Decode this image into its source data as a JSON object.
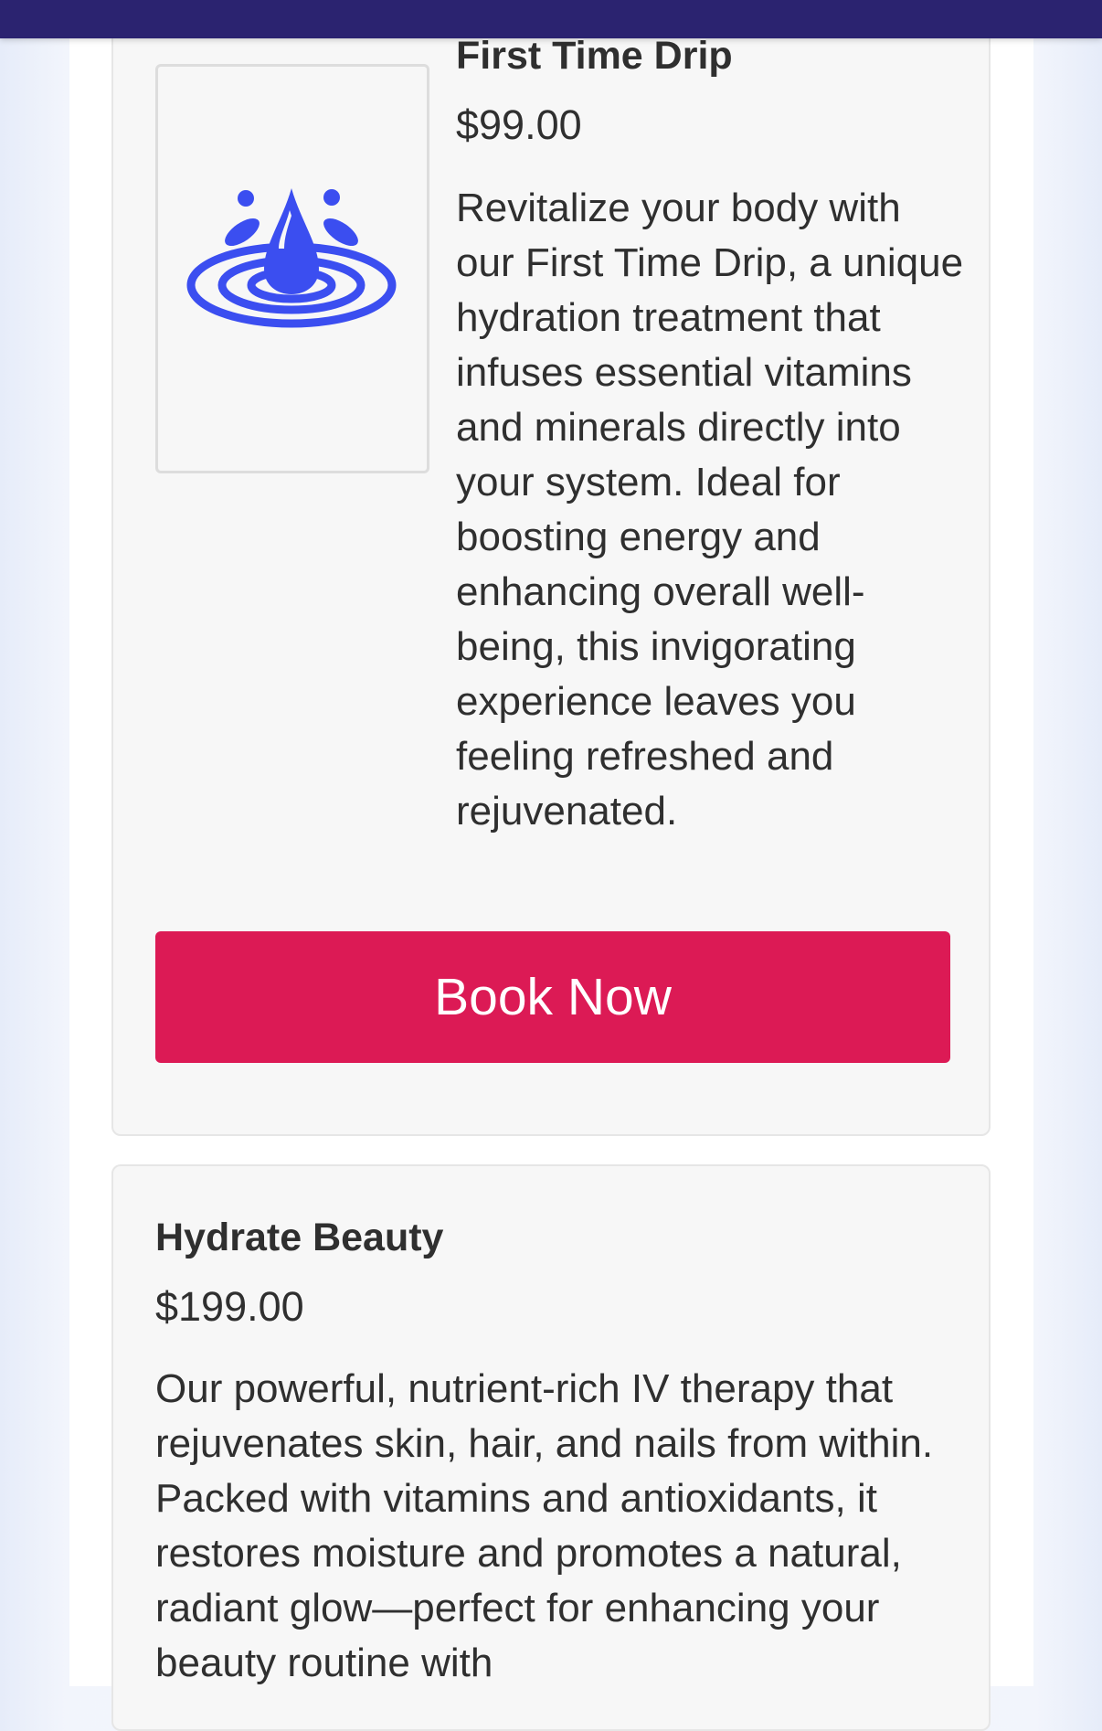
{
  "colors": {
    "header": "#2b2370",
    "accent_button": "#dc1a55",
    "icon": "#3b4ef0"
  },
  "services": [
    {
      "icon": "water-drop-ripple-icon",
      "title": "First Time Drip",
      "price": "$99.00",
      "description": "Revitalize your body with our First Time Drip, a unique hydration treatment that infuses essential vitamins and minerals directly into your system. Ideal for boosting energy and enhancing overall well-being, this invigorating experience leaves you feeling refreshed and rejuvenated.",
      "button_label": "Book Now"
    },
    {
      "title": "Hydrate Beauty",
      "price": "$199.00",
      "description": "Our powerful, nutrient-rich IV therapy that rejuvenates skin, hair, and nails from within. Packed with vitamins and antioxidants, it restores moisture and promotes a natural, radiant glow—perfect for enhancing your beauty routine with"
    }
  ]
}
